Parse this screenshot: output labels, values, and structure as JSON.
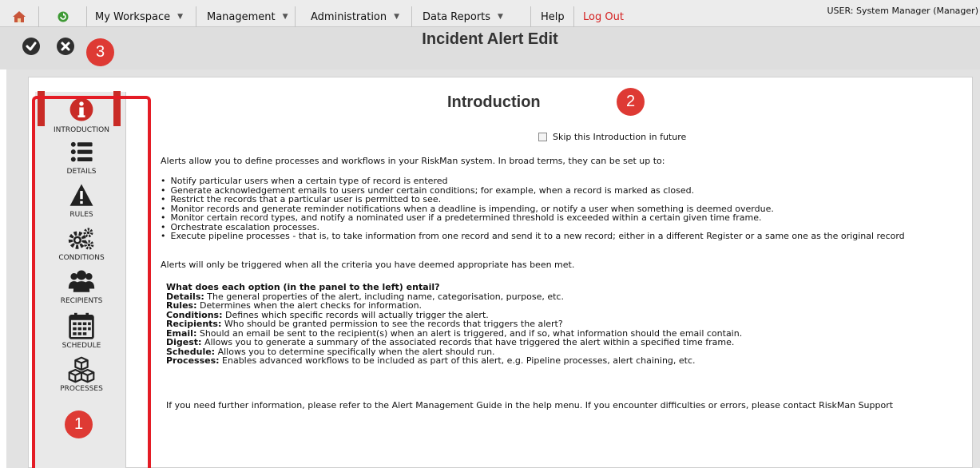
{
  "menu": {
    "items": [
      {
        "label": "My Workspace",
        "caret": "▼"
      },
      {
        "label": "Management",
        "caret": "▼"
      },
      {
        "label": "Administration",
        "caret": "▼"
      },
      {
        "label": "Data Reports",
        "caret": "▼"
      },
      {
        "label": "Help"
      },
      {
        "label": "Log Out"
      }
    ],
    "icons": [
      "home-icon",
      "refresh-icon"
    ]
  },
  "user": {
    "label": "USER: System Manager (Manager)"
  },
  "title": {
    "text": "Incident Alert Edit"
  },
  "toolbar": {
    "save_icon": "check-icon",
    "cancel_icon": "close-icon"
  },
  "badges": {
    "b1": "1",
    "b2": "2",
    "b3": "3"
  },
  "sidebar": {
    "items": [
      {
        "label": "INTRODUCTION",
        "icon": "info-icon"
      },
      {
        "label": "DETAILS",
        "icon": "list-icon"
      },
      {
        "label": "RULES",
        "icon": "warning-icon"
      },
      {
        "label": "CONDITIONS",
        "icon": "gears-icon"
      },
      {
        "label": "RECIPIENTS",
        "icon": "users-icon"
      },
      {
        "label": "SCHEDULE",
        "icon": "calendar-icon"
      },
      {
        "label": "PROCESSES",
        "icon": "cubes-icon"
      }
    ]
  },
  "content": {
    "heading": "Introduction",
    "skip_label": "Skip this Introduction in future",
    "intro": "Alerts allow you to define processes and workflows in your RiskMan system. In broad terms, they can be set up to:",
    "bullets": [
      "Notify particular users when a certain type of record is entered",
      "Generate acknowledgement emails to users under certain conditions; for example, when a record is marked as closed.",
      "Restrict the records that a particular user is permitted to see.",
      "Monitor records and generate reminder notifications when a deadline is impending, or notify a user when something is deemed overdue.",
      "Monitor certain record types, and notify a nominated user if a predetermined threshold is exceeded within a certain given time frame.",
      "Orchestrate escalation processes.",
      "Execute pipeline processes - that is, to take information from one record and send it to a new record; either in a different Register or a same one as the original record"
    ],
    "triggered": "Alerts will only be triggered when all the criteria you have deemed appropriate has been met.",
    "options_heading": "What does each option (in the panel to the left) entail?",
    "options": [
      {
        "term": "Details:",
        "desc": "The general properties of the alert, including name, categorisation, purpose, etc."
      },
      {
        "term": "Rules:",
        "desc": "Determines when the alert checks for information."
      },
      {
        "term": "Conditions:",
        "desc": "Defines which specific records will actually trigger the alert."
      },
      {
        "term": "Recipients:",
        "desc": "Who should be granted permission to see the records that triggers the alert?"
      },
      {
        "term": "Email:",
        "desc": "Should an email be sent to the recipient(s) when an alert is triggered, and if so, what information should the email contain."
      },
      {
        "term": "Digest:",
        "desc": "Allows you to generate a summary of the associated records that have triggered the alert within a specified time frame."
      },
      {
        "term": "Schedule:",
        "desc": "Allows you to determine specifically when the alert should run."
      },
      {
        "term": "Processes:",
        "desc": "Enables advanced workflows to be included as part of this alert, e.g. Pipeline processes, alert chaining, etc."
      }
    ],
    "footer": "If you need further information, please refer to the Alert Management Guide in the help menu. If you encounter difficulties or errors, please contact RiskMan Support"
  },
  "colors": {
    "accent_red": "#de3a34",
    "highlight_red": "#e41c25",
    "logout_red": "#d42020"
  }
}
